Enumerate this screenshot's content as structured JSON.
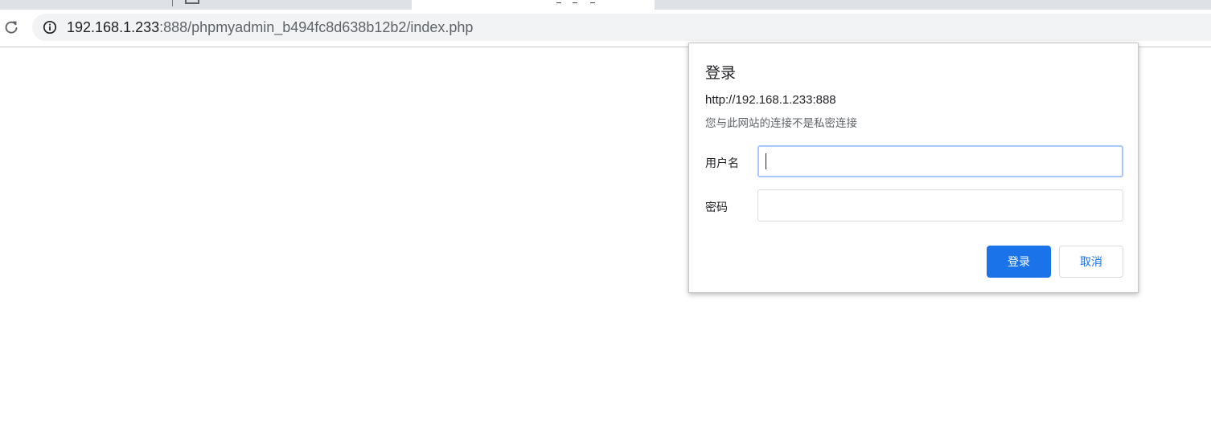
{
  "browser": {
    "url_host": "192.168.1.233",
    "url_rest": ":888/phpmyadmin_b494fc8d638b12b2/index.php"
  },
  "icons": {
    "reload": "reload-icon",
    "info": "info-icon"
  },
  "auth_dialog": {
    "title": "登录",
    "origin": "http://192.168.1.233:888",
    "note": "您与此网站的连接不是私密连接",
    "username_label": "用户名",
    "username_value": "",
    "password_label": "密码",
    "password_value": "",
    "login_button": "登录",
    "cancel_button": "取消"
  },
  "colors": {
    "accent": "#1a73e8",
    "focus_border": "#a8c7fa",
    "chrome_bg": "#dee1e6",
    "omnibox_bg": "#f1f3f4"
  }
}
